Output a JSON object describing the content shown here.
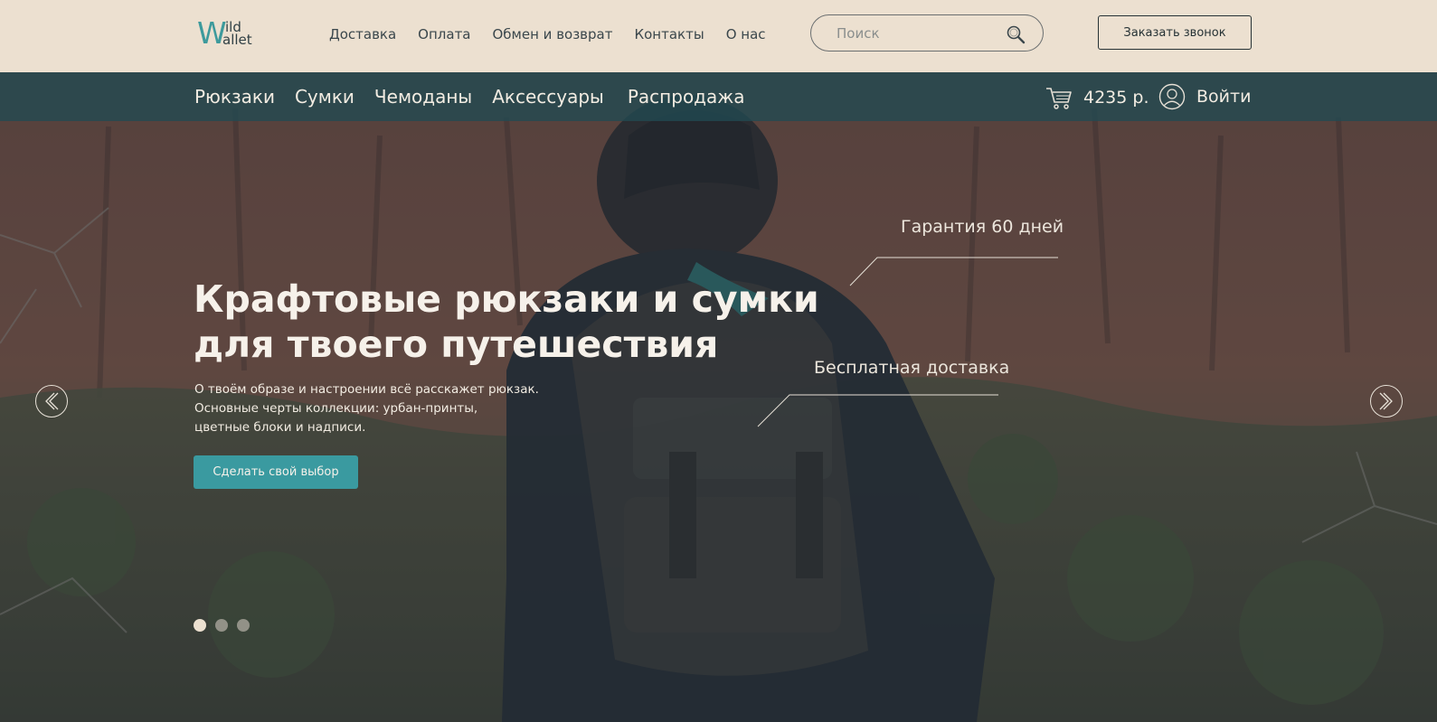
{
  "header": {
    "logo": {
      "letter": "W",
      "top": "ild",
      "bottom": "allet"
    },
    "nav": [
      "Доставка",
      "Оплата",
      "Обмен и возврат",
      "Контакты",
      "О нас"
    ],
    "search": {
      "placeholder": "Поиск",
      "value": ""
    },
    "callback_label": "Заказать звонок"
  },
  "category_nav": {
    "items": [
      "Рюкзаки",
      "Сумки",
      "Чемоданы",
      "Аксессуары",
      "Распродажа"
    ],
    "cart_total": "4235 р.",
    "login_label": "Войти"
  },
  "hero": {
    "title_line1": "Крафтовые рюкзаки и сумки",
    "title_line2": "для твоего путешествия",
    "desc_line1": "О твоём образе и настроении всё расскажет рюкзак.",
    "desc_line2": "Основные черты коллекции: урбан-принты,",
    "desc_line3": "цветные блоки и надписи.",
    "cta_label": "Сделать свой выбор",
    "callout_1": "Гарантия 60 дней",
    "callout_2": "Бесплатная доставка",
    "slides": 3,
    "active_slide": 1
  },
  "colors": {
    "topbar_bg": "#ece0d0",
    "accent": "#3a9aa0",
    "catnav_bg": "#214a52"
  },
  "icons": [
    "search-icon",
    "cart-icon",
    "user-icon",
    "chevron-left-icon",
    "chevron-right-icon"
  ]
}
